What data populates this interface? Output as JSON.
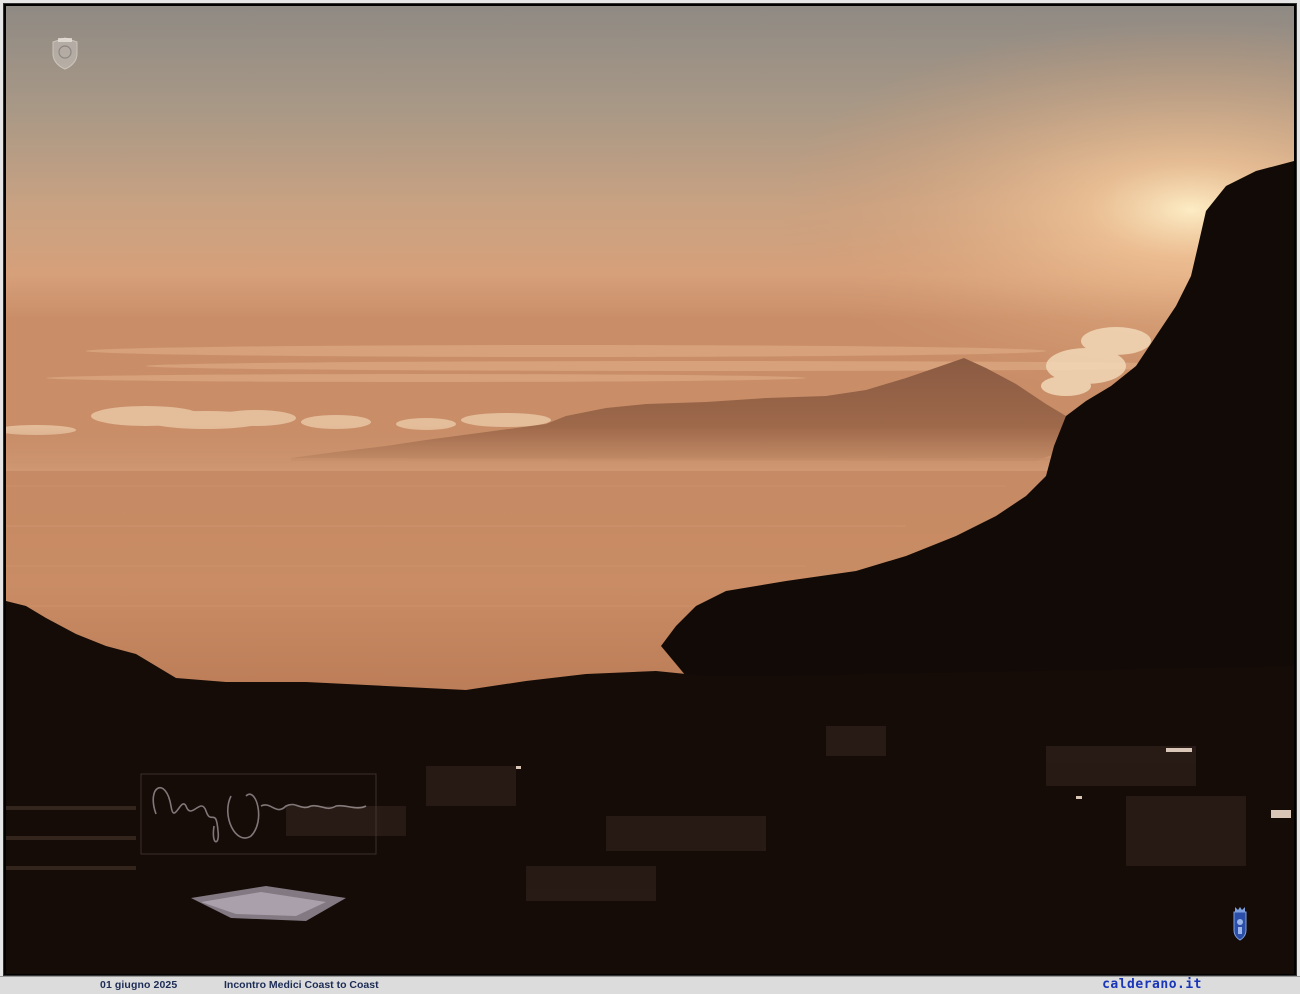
{
  "caption": {
    "date": "01 giugno  2025",
    "title": "Incontro Medici Coast to Coast",
    "site": "calderano.it"
  },
  "watermarks": {
    "top_logo": "crest-watermark-icon",
    "bottom_logo": "coat-of-arms-icon",
    "signature": "handwritten-signature"
  },
  "colors": {
    "sky_top": "#9a8f84",
    "sky_glow": "#e8b890",
    "horizon": "#c98a5e",
    "sea": "#c88a62",
    "land_shadow": "#120a07",
    "caption_text": "#1c2c55",
    "site_link": "#1a35b8"
  }
}
